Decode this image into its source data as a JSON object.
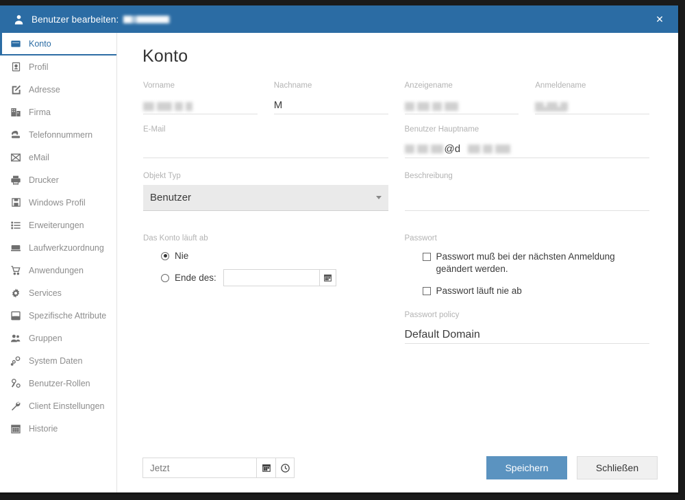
{
  "titlebar": {
    "icon": "user-icon",
    "title": "Benutzer bearbeiten:",
    "redacted_value": "",
    "close_label": "✕"
  },
  "colors": {
    "header_blue": "#2b6ca4",
    "accent_blue": "#2b6ca4",
    "primary_button": "#5b93c0",
    "label_gray": "#b3b3b3",
    "text_dark": "#3b3b3b"
  },
  "sidebar": {
    "items": [
      {
        "label": "Konto",
        "icon": "card-icon",
        "active": true
      },
      {
        "label": "Profil",
        "icon": "id-badge-icon",
        "active": false
      },
      {
        "label": "Adresse",
        "icon": "edit-square-icon",
        "active": false
      },
      {
        "label": "Firma",
        "icon": "building-icon",
        "active": false
      },
      {
        "label": "Telefonnummern",
        "icon": "phone-icon",
        "active": false
      },
      {
        "label": "eMail",
        "icon": "envelope-icon",
        "active": false
      },
      {
        "label": "Drucker",
        "icon": "printer-icon",
        "active": false
      },
      {
        "label": "Windows Profil",
        "icon": "floppy-disk-icon",
        "active": false
      },
      {
        "label": "Erweiterungen",
        "icon": "list-icon",
        "active": false
      },
      {
        "label": "Laufwerkzuordnung",
        "icon": "drive-icon",
        "active": false
      },
      {
        "label": "Anwendungen",
        "icon": "cart-icon",
        "active": false
      },
      {
        "label": "Services",
        "icon": "gear-icon",
        "active": false
      },
      {
        "label": "Spezifische Attribute",
        "icon": "inbox-icon",
        "active": false
      },
      {
        "label": "Gruppen",
        "icon": "users-icon",
        "active": false
      },
      {
        "label": "System Daten",
        "icon": "nodes-icon",
        "active": false
      },
      {
        "label": "Benutzer-Rollen",
        "icon": "user-key-icon",
        "active": false
      },
      {
        "label": "Client Einstellungen",
        "icon": "wrench-icon",
        "active": false
      },
      {
        "label": "Historie",
        "icon": "calendar-icon",
        "active": false
      }
    ]
  },
  "main": {
    "page_title": "Konto",
    "fields": {
      "vorname": {
        "label": "Vorname",
        "value": "",
        "redacted": true
      },
      "nachname": {
        "label": "Nachname",
        "value": "M",
        "redacted": false
      },
      "anzeigename": {
        "label": "Anzeigename",
        "value": "",
        "redacted": true
      },
      "anmeldename": {
        "label": "Anmeldename",
        "value": "",
        "redacted": true
      },
      "email": {
        "label": "E-Mail",
        "value": "",
        "redacted": false
      },
      "hauptname": {
        "label": "Benutzer Hauptname",
        "value": "@d",
        "redacted": true
      },
      "beschreibung": {
        "label": "Beschreibung",
        "value": "",
        "redacted": false
      }
    },
    "objekt_typ": {
      "label": "Objekt Typ",
      "selected": "Benutzer",
      "options": [
        "Benutzer"
      ]
    },
    "konto_laeuft_ab": {
      "label": "Das Konto läuft ab",
      "option_nie": "Nie",
      "option_ende": "Ende des:",
      "selected": "Nie",
      "end_date_value": "",
      "calendar_icon": "calendar-icon"
    },
    "passwort": {
      "label": "Passwort",
      "checkbox_change_next_login": "Passwort muß bei der nächsten Anmeldung geändert werden.",
      "checkbox_change_next_login_checked": false,
      "checkbox_never_expires": "Passwort läuft nie ab",
      "checkbox_never_expires_checked": false
    },
    "passwort_policy": {
      "label": "Passwort policy",
      "value": "Default Domain"
    }
  },
  "footer": {
    "now_input_value": "Jetzt",
    "calendar_icon": "calendar-icon",
    "clock_icon": "clock-icon",
    "save_label": "Speichern",
    "close_label": "Schließen"
  }
}
